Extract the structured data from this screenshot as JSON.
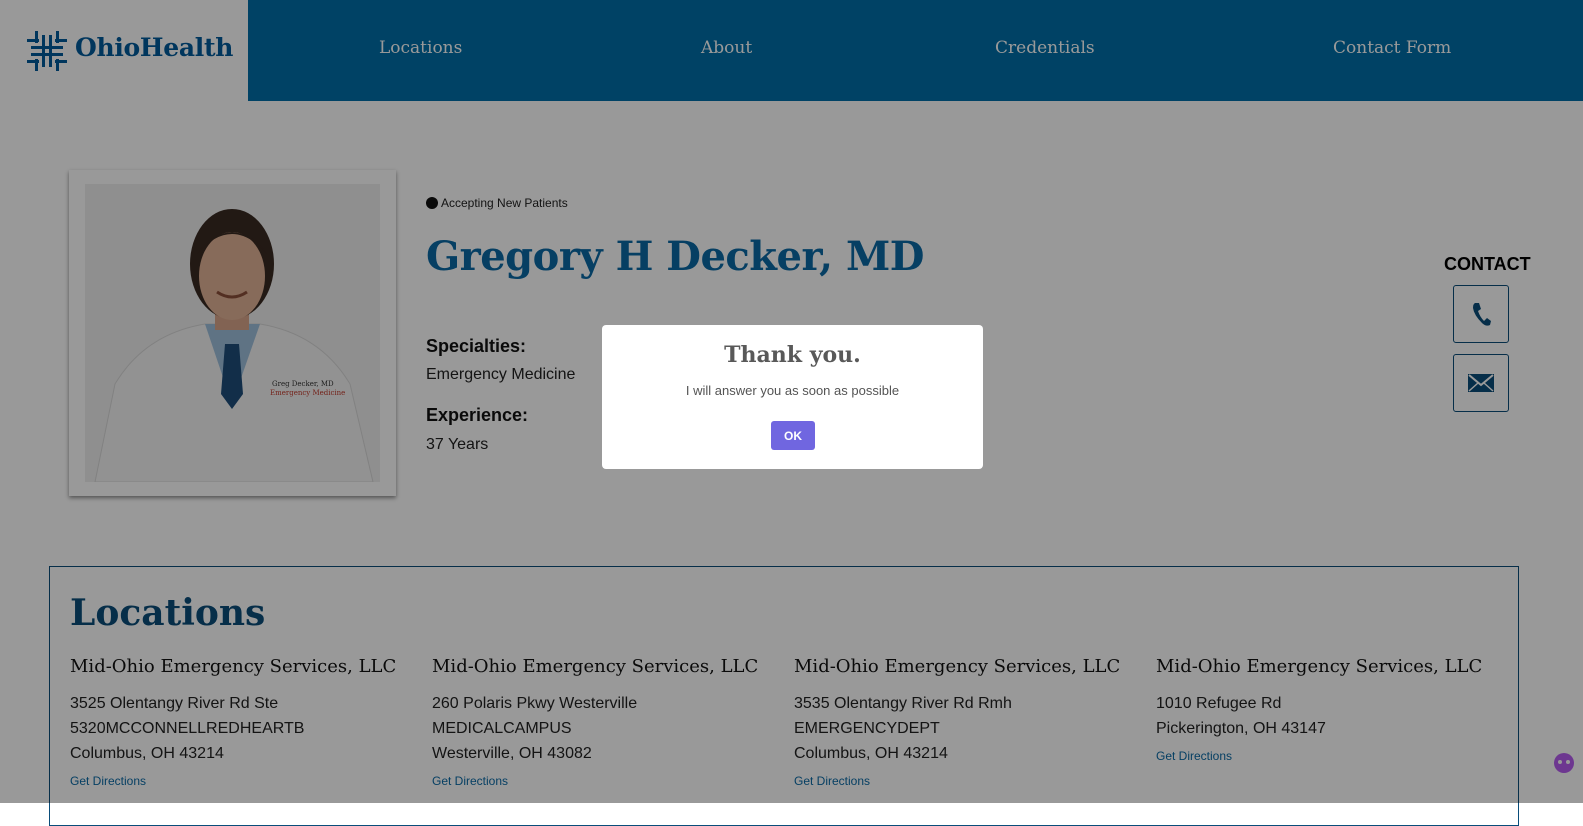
{
  "brand": {
    "name": "OhioHealth"
  },
  "nav": {
    "items": [
      {
        "label": "Locations"
      },
      {
        "label": "About"
      },
      {
        "label": "Credentials"
      },
      {
        "label": "Contact Form"
      }
    ]
  },
  "profile": {
    "status": "Accepting New Patients",
    "name": "Gregory H Decker, MD",
    "specialties_label": "Specialties:",
    "specialties_value": "Emergency Medicine",
    "experience_label": "Experience:",
    "experience_value": "37 Years",
    "photo_coat_text": "Greg Decker, MD",
    "photo_coat_dept": "Emergency Medicine"
  },
  "contact": {
    "title": "CONTACT",
    "phone_icon": "phone-icon",
    "email_icon": "envelope-icon"
  },
  "locations": {
    "title": "Locations",
    "items": [
      {
        "name": "Mid-Ohio Emergency Services, LLC",
        "line1": "3525 Olentangy River Rd Ste",
        "line2": "5320MCCONNELLREDHEARTB",
        "line3": "Columbus, OH 43214",
        "directions": "Get Directions"
      },
      {
        "name": "Mid-Ohio Emergency Services, LLC",
        "line1": "260 Polaris Pkwy Westerville",
        "line2": "MEDICALCAMPUS",
        "line3": "Westerville, OH 43082",
        "directions": "Get Directions"
      },
      {
        "name": "Mid-Ohio Emergency Services, LLC",
        "line1": "3535 Olentangy River Rd Rmh",
        "line2": "EMERGENCYDEPT",
        "line3": "Columbus, OH 43214",
        "directions": "Get Directions"
      },
      {
        "name": "Mid-Ohio Emergency Services, LLC",
        "line1": "1010 Refugee Rd",
        "line2": "Pickerington, OH 43147",
        "line3": "",
        "directions": "Get Directions"
      }
    ]
  },
  "modal": {
    "title": "Thank you.",
    "message": "I will answer you as soon as possible",
    "ok_label": "OK"
  },
  "colors": {
    "brand_blue": "#006fa8",
    "heading_blue": "#0a6aa6",
    "button_purple": "#7066e0"
  }
}
